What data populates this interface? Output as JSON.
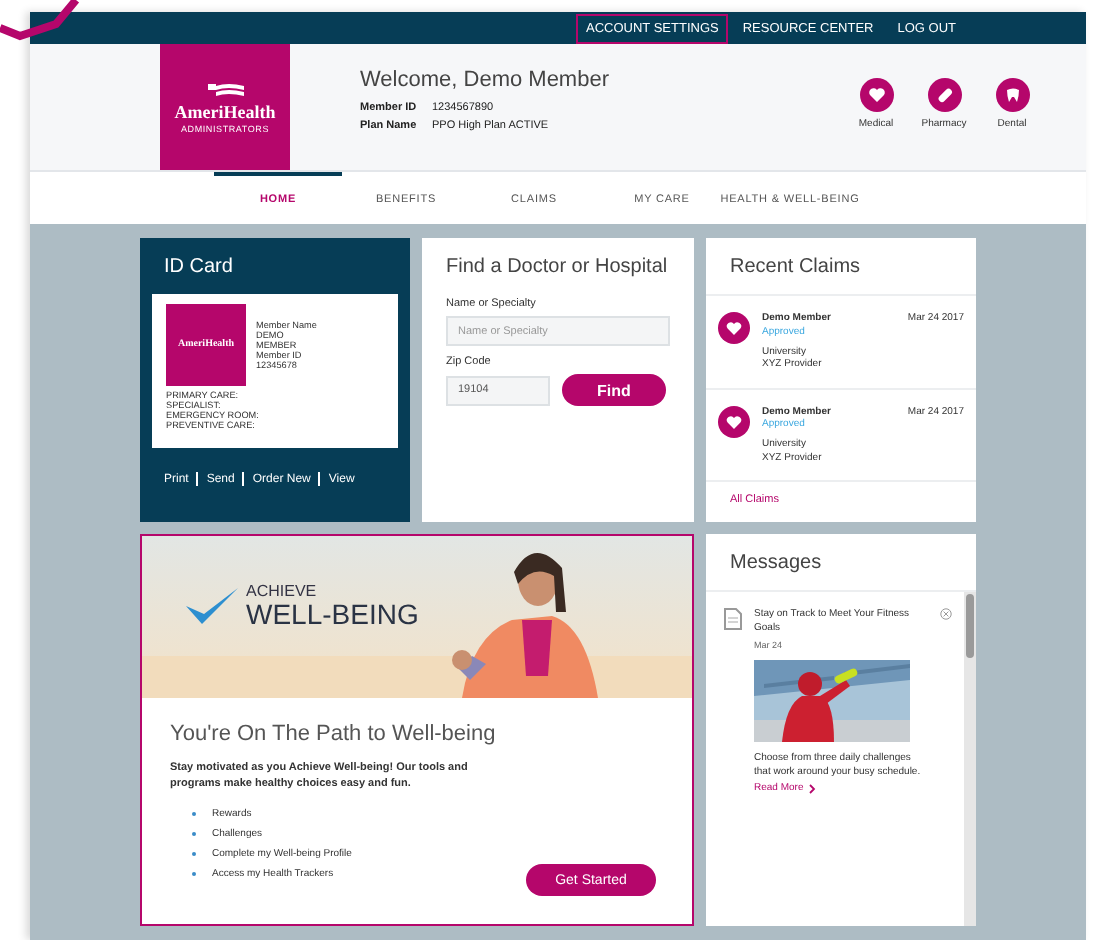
{
  "top_links": [
    {
      "label": "ACCOUNT SETTINGS",
      "selected": true
    },
    {
      "label": "RESOURCE CENTER",
      "selected": false
    },
    {
      "label": "LOG OUT",
      "selected": false
    }
  ],
  "logo": {
    "name": "AmeriHealth",
    "tagline": "ADMINISTRATORS"
  },
  "member": {
    "welcome": "Welcome, Demo Member",
    "fields": [
      {
        "label": "Member ID",
        "value": "1234567890"
      },
      {
        "label": "Plan Name",
        "value": "PPO High Plan ACTIVE"
      }
    ]
  },
  "quick_links": [
    {
      "label": "Medical",
      "kind": "heart"
    },
    {
      "label": "Pharmacy",
      "kind": "pill"
    },
    {
      "label": "Dental",
      "kind": "tooth"
    }
  ],
  "nav": [
    {
      "label": "HOME",
      "selected": true
    },
    {
      "label": "BENEFITS",
      "selected": false
    },
    {
      "label": "CLAIMS",
      "selected": false
    },
    {
      "label": "MY CARE",
      "selected": false
    },
    {
      "label": "HEALTH & WELL-BEING",
      "selected": false
    }
  ],
  "id_card": {
    "title": "ID Card",
    "card_logo": "AmeriHealth",
    "member_lines": [
      "Member Name",
      "DEMO",
      "MEMBER",
      "Member ID",
      "12345678"
    ],
    "coverage_lines": [
      "PRIMARY CARE:",
      "SPECIALIST:",
      "EMERGENCY ROOM:",
      "PREVENTIVE CARE:"
    ],
    "actions": [
      "Print",
      "Send",
      "Order New",
      "View"
    ]
  },
  "find_doctor": {
    "title": "Find a Doctor or Hospital",
    "fields": [
      {
        "label": "Name or Specialty",
        "placeholder": "Name or Specialty"
      },
      {
        "label": "Zip Code",
        "value": "19104"
      }
    ],
    "button": "Find"
  },
  "recent_claims": {
    "title": "Recent Claims",
    "items": [
      {
        "name": "Demo Member",
        "status": "Approved",
        "date": "Mar 24 2017",
        "provider": [
          "University",
          "XYZ Provider"
        ]
      },
      {
        "name": "Demo Member",
        "status": "Approved",
        "date": "Mar 24 2017",
        "provider": [
          "University",
          "XYZ Provider"
        ]
      }
    ],
    "link": "All Claims"
  },
  "well_being": {
    "banner": {
      "brand_top": "ACHIEVE",
      "brand_main": "WELL-BEING"
    },
    "heading": "You're On The Path to Well-being",
    "body": "Stay motivated as you Achieve Well-being! Our tools and programs make healthy choices easy and fun.",
    "bullets": [
      "Rewards",
      "Challenges",
      "Complete my Well-being Profile",
      "Access my Health Trackers"
    ],
    "button": "Get Started"
  },
  "messages": {
    "title": "Messages",
    "items": [
      {
        "title": "Stay on Track to Meet Your Fitness Goals",
        "date": "Mar 24",
        "body": "Choose from three daily challenges that work around your busy schedule.",
        "link": "Read More"
      }
    ]
  }
}
